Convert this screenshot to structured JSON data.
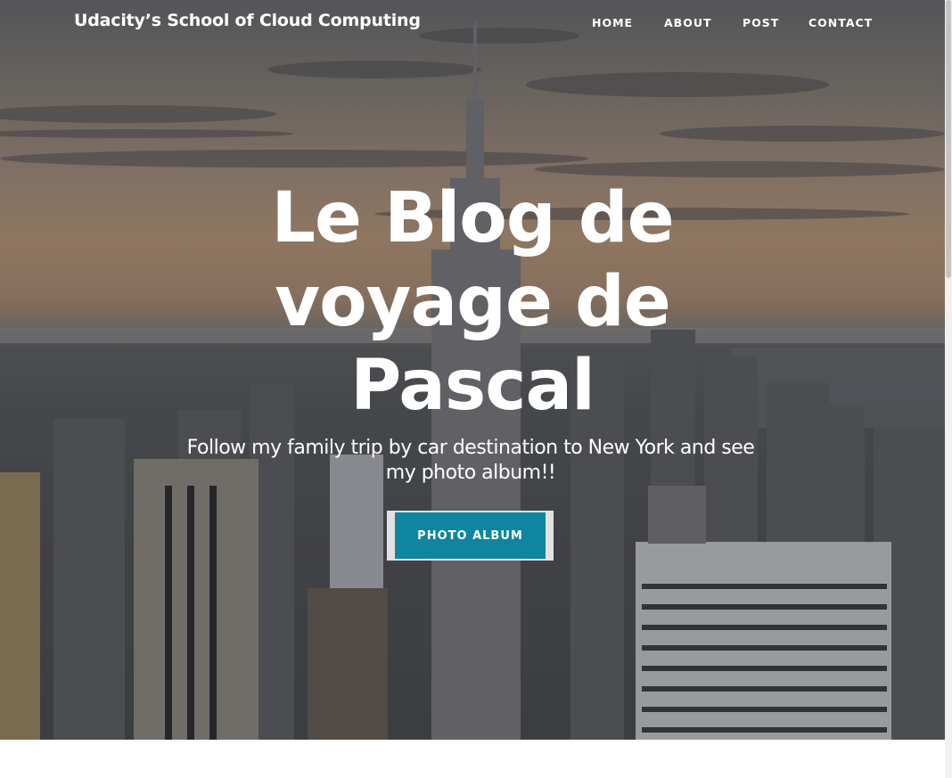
{
  "header": {
    "brand": "Udacity’s School of Cloud Computing",
    "nav": [
      "HOME",
      "ABOUT",
      "POST",
      "CONTACT"
    ]
  },
  "hero": {
    "title": "Le Blog de voyage de Pascal",
    "subtitle": "Follow my family trip by car destination to New York and see my photo album!!",
    "button_label": "PHOTO ALBUM",
    "background_image": "New York City skyline at dusk with the Empire State Building"
  },
  "colors": {
    "button": "#0f85a0",
    "button_border": "#e2e2e2",
    "text": "#ffffff"
  }
}
